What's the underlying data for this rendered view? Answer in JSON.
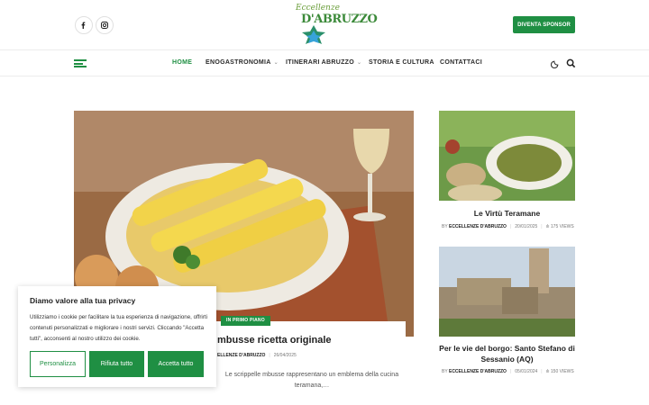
{
  "header": {
    "logo_script": "Eccellenze",
    "logo_main": "D'ABRUZZO",
    "sponsor_button": "DIVENTA SPONSOR"
  },
  "nav": {
    "items": [
      {
        "label": "HOME",
        "active": true
      },
      {
        "label": "ENOGASTRONOMIA",
        "has_dropdown": true
      },
      {
        "label": "ITINERARI ABRUZZO",
        "has_dropdown": true
      },
      {
        "label": "STORIA E CULTURA"
      },
      {
        "label": "CONTATTACI"
      }
    ]
  },
  "hero": {
    "category": "IN PRIMO PIANO",
    "title_visible": "mbusse ricetta originale",
    "author_visible": "ELLENZE D'ABRUZZO",
    "date": "26/04/2025",
    "excerpt": "Le scrippelle mbusse rappresentano un emblema della cucina teramana,…"
  },
  "side_posts": [
    {
      "title": "Le Virtù Teramane",
      "by": "BY",
      "author": "ECCELLENZE D'ABRUZZO",
      "date": "20/01/2025",
      "views": "175 VIEWS"
    },
    {
      "title": "Per le vie del borgo: Santo Stefano di Sessanio (AQ)",
      "by": "BY",
      "author": "ECCELLENZE D'ABRUZZO",
      "date": "05/01/2024",
      "views": "150 VIEWS"
    }
  ],
  "cookie": {
    "title": "Diamo valore alla tua privacy",
    "text": "Utilizziamo i cookie per facilitare la tua esperienza di navigazione, offrirti contenuti personalizzati e migliorare i nostri servizi. Cliccando \"Accetta tutti\", acconsenti al nostro utilizzo dei cookie.",
    "btn_customize": "Personalizza",
    "btn_reject": "Rifiuta tutto",
    "btn_accept": "Accetta tutto"
  },
  "colors": {
    "accent": "#1f8f43"
  }
}
